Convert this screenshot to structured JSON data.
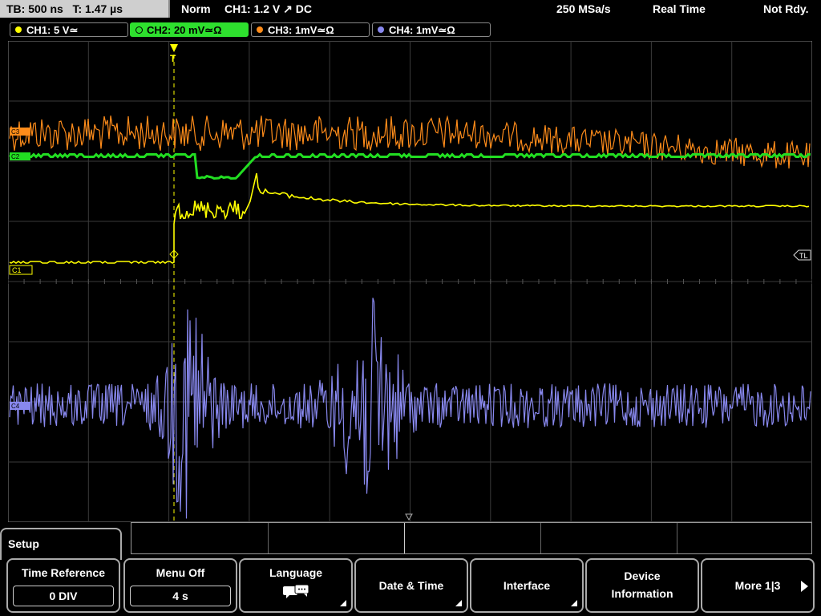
{
  "status_bar": {
    "timebase": "TB: 500 ns",
    "trigger_time": "T: 1.47 µs",
    "mode": "Norm",
    "trigger_info": "CH1: 1.2 V ↗ DC",
    "sample_rate": "250 MSa/s",
    "acq_mode": "Real Time",
    "status": "Not Rdy."
  },
  "channels": [
    {
      "label": "CH1: 5 V≃",
      "color": "#ffff00",
      "active": false
    },
    {
      "label": "CH2: 20 mV≃Ω",
      "color": "#22dd22",
      "active": true
    },
    {
      "label": "CH3: 1mV≃Ω",
      "color": "#ff8c1a",
      "active": false
    },
    {
      "label": "CH4: 1mV≃Ω",
      "color": "#8888ee",
      "active": false
    }
  ],
  "markers": {
    "c1": "C1",
    "c2": "C2",
    "c3": "C3",
    "c4": "C4",
    "trigger_level": "TL"
  },
  "menu": {
    "title": "Setup",
    "softkeys": [
      {
        "label": "Time Reference",
        "value": "0 DIV"
      },
      {
        "label": "Menu Off",
        "value": "4 s"
      },
      {
        "label": "Language",
        "icon": "speech-bubble-icon"
      },
      {
        "label": "Date & Time"
      },
      {
        "label": "Interface"
      },
      {
        "label": "Device",
        "label2": "Information"
      },
      {
        "label": "More 1|3"
      }
    ]
  }
}
